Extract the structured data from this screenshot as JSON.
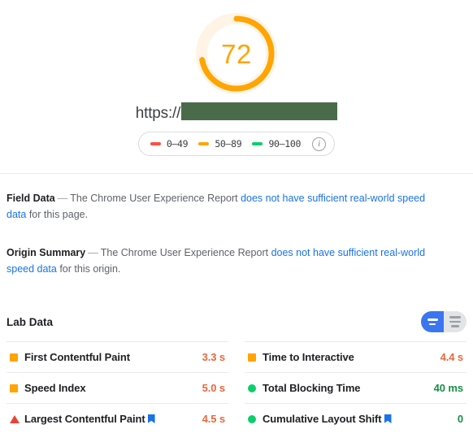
{
  "gauge": {
    "score": "72",
    "max": 100,
    "arc_color": "#FFA400",
    "track_color": "#FFF4E5",
    "score_color": "#FFA400"
  },
  "url": {
    "prefix": "https://",
    "redacted": true,
    "redaction_color": "#4a6b4a"
  },
  "legend": {
    "items": [
      {
        "label": "0–49",
        "color": "#FF4E42",
        "name": "range-poor"
      },
      {
        "label": "50–89",
        "color": "#FFA400",
        "name": "range-average"
      },
      {
        "label": "90–100",
        "color": "#0CCE6B",
        "name": "range-good"
      }
    ],
    "info_glyph": "i"
  },
  "field_data": {
    "title": "Field Data",
    "dash": "—",
    "text_before": "The Chrome User Experience Report ",
    "link": "does not have sufficient real-world speed data",
    "text_after": " for this page."
  },
  "origin_summary": {
    "title": "Origin Summary",
    "dash": "—",
    "text_before": "The Chrome User Experience Report ",
    "link": "does not have sufficient real-world speed data",
    "text_after": " for this origin."
  },
  "lab_data": {
    "title": "Lab Data",
    "toggle": {
      "active_view": "condensed",
      "active_color": "#3b76f0",
      "inactive_color": "#e3e4e6",
      "options": [
        {
          "name": "view-condensed-button",
          "lines": 2,
          "active": true
        },
        {
          "name": "view-expanded-button",
          "lines": 3,
          "active": false
        }
      ]
    },
    "columns": [
      {
        "name": "metrics-column-left",
        "rows": [
          {
            "name": "metric-first-contentful-paint",
            "icon": "square",
            "icon_color": "#FFA400",
            "label": "First Contentful Paint",
            "flag": false,
            "value": "3.3 s",
            "value_color": "#E8683D"
          },
          {
            "name": "metric-speed-index",
            "icon": "square",
            "icon_color": "#FFA400",
            "label": "Speed Index",
            "flag": false,
            "value": "5.0 s",
            "value_color": "#E8683D"
          },
          {
            "name": "metric-largest-contentful-paint",
            "icon": "triangle",
            "icon_color": "#EA4335",
            "label": "Largest Contentful Paint",
            "flag": true,
            "value": "4.5 s",
            "value_color": "#E8683D"
          }
        ]
      },
      {
        "name": "metrics-column-right",
        "rows": [
          {
            "name": "metric-time-to-interactive",
            "icon": "square",
            "icon_color": "#FFA400",
            "label": "Time to Interactive",
            "flag": false,
            "value": "4.4 s",
            "value_color": "#E8683D"
          },
          {
            "name": "metric-total-blocking-time",
            "icon": "circle",
            "icon_color": "#0CCE6B",
            "label": "Total Blocking Time",
            "flag": false,
            "value": "40 ms",
            "value_color": "#178D46"
          },
          {
            "name": "metric-cumulative-layout-shift",
            "icon": "circle",
            "icon_color": "#0CCE6B",
            "label": "Cumulative Layout Shift",
            "flag": true,
            "value": "0",
            "value_color": "#178D46"
          }
        ]
      }
    ]
  }
}
